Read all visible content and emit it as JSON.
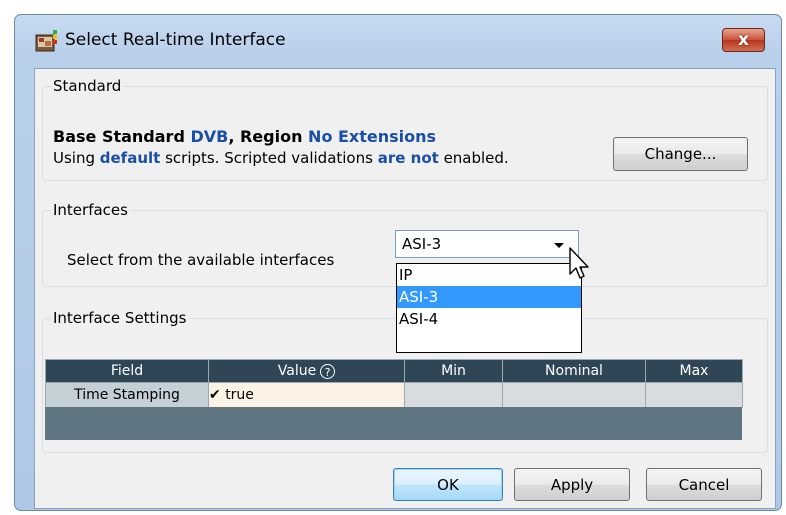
{
  "window": {
    "title": "Select Real-time Interface",
    "close_label": "x"
  },
  "standard": {
    "legend": "Standard",
    "line1_prefix": "Base Standard ",
    "base_standard": "DVB",
    "line1_mid": ", Region ",
    "region": "No Extensions",
    "line2_prefix": "Using ",
    "scripts": "default",
    "line2_mid": " scripts. Scripted validations ",
    "validations": "are not",
    "line2_suffix": " enabled.",
    "change_label": "Change..."
  },
  "interfaces": {
    "legend": "Interfaces",
    "label": "Select from the available interfaces",
    "selected": "ASI-3",
    "options": [
      "IP",
      "ASI-3",
      "ASI-4"
    ],
    "highlighted_index": 1
  },
  "settings": {
    "legend": "Interface Settings",
    "columns": {
      "field": "Field",
      "value": "Value",
      "min": "Min",
      "nominal": "Nominal",
      "max": "Max"
    },
    "help_glyph": "?",
    "rows": [
      {
        "field": "Time Stamping",
        "check": "✔",
        "value": "true"
      }
    ]
  },
  "buttons": {
    "ok": "OK",
    "apply": "Apply",
    "cancel": "Cancel"
  },
  "colors": {
    "accent_text": "#1a4fa6",
    "header_bg": "#2f4656",
    "selection": "#3399ff"
  }
}
